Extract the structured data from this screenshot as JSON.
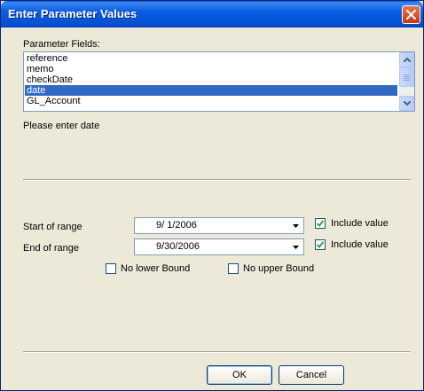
{
  "dialog": {
    "title": "Enter Parameter Values",
    "close_icon": "close-icon"
  },
  "parameter_fields": {
    "label": "Parameter Fields:",
    "items": [
      "reference",
      "memo",
      "checkDate",
      "date",
      "GL_Account"
    ],
    "selected": "date"
  },
  "prompt": "Please enter date",
  "range": {
    "start": {
      "label": "Start of range",
      "value": "9/ 1/2006",
      "include_label": "Include value",
      "include_checked": true
    },
    "end": {
      "label": "End of range",
      "value": "9/30/2006",
      "include_label": "Include value",
      "include_checked": true
    },
    "no_lower_bound": {
      "label": "No lower Bound",
      "checked": false
    },
    "no_upper_bound": {
      "label": "No upper Bound",
      "checked": false
    }
  },
  "buttons": {
    "ok": "OK",
    "cancel": "Cancel"
  },
  "colors": {
    "titlebar": "#0551d4",
    "selection": "#316ac5",
    "dialog_bg": "#ece9d8",
    "close_button": "#c5390f"
  }
}
